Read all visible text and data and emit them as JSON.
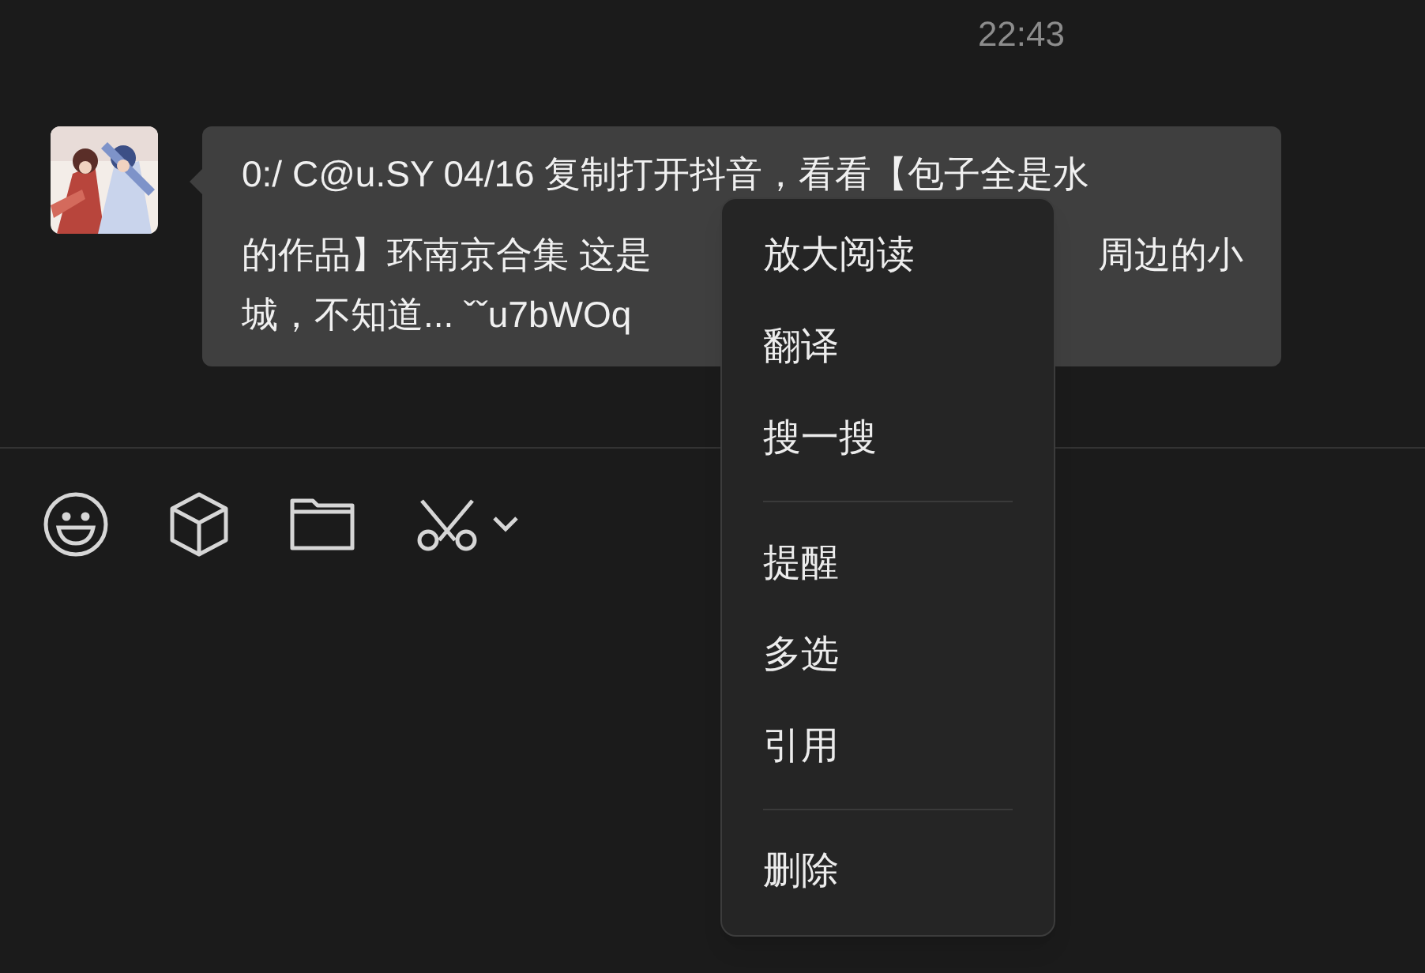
{
  "time": "22:43",
  "message": {
    "lines": [
      {
        "left": "0:/ C@u.SY 04/16 复制打开抖音，看看【包子全是水"
      },
      {
        "left": "的作品】环南京合集 这是",
        "right": "周边的小"
      },
      {
        "left": "城，不知道... ˇˇu7bWOq"
      }
    ]
  },
  "context_menu": {
    "groups": [
      [
        "放大阅读",
        "翻译",
        "搜一搜"
      ],
      [
        "提醒",
        "多选",
        "引用"
      ],
      [
        "删除"
      ]
    ]
  }
}
